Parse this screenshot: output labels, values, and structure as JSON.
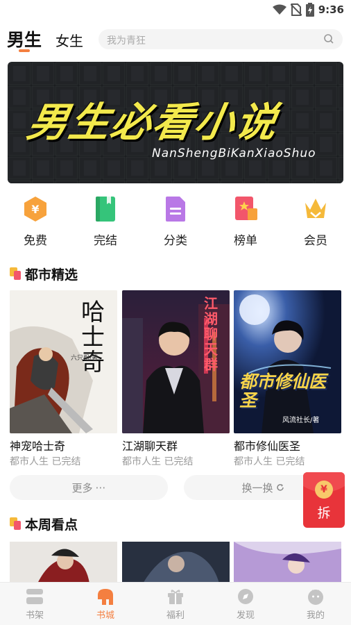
{
  "status_bar": {
    "time": "9:36",
    "icons": [
      "wifi-icon",
      "no-sim-icon",
      "battery-charging-icon"
    ]
  },
  "header": {
    "tabs": [
      {
        "label": "男生",
        "active": true
      },
      {
        "label": "女生",
        "active": false
      }
    ],
    "search_placeholder": "我为青狂",
    "accent": "#f47f40"
  },
  "banner": {
    "title": "男生必看小说",
    "subtitle": "NanShengBiKanXiaoShuo"
  },
  "categories": [
    {
      "label": "免费",
      "icon": "coin-icon",
      "color": "#f7a23c"
    },
    {
      "label": "完结",
      "icon": "book-icon",
      "color": "#35c47a"
    },
    {
      "label": "分类",
      "icon": "document-icon",
      "color": "#b978e6"
    },
    {
      "label": "榜单",
      "icon": "rank-flag-icon",
      "color": "#f2566b"
    },
    {
      "label": "会员",
      "icon": "crown-icon",
      "color": "#f5b93a"
    }
  ],
  "sections": [
    {
      "title": "都市精选",
      "books": [
        {
          "title": "神宠哈士奇",
          "meta": "都市人生 已完结",
          "cover_text": "哈士奇",
          "cover_author": "六只粗/著"
        },
        {
          "title": "江湖聊天群",
          "meta": "都市人生 已完结",
          "cover_text": "江湖聊天群",
          "cover_author": ""
        },
        {
          "title": "都市修仙医圣",
          "meta": "都市人生 已完结",
          "cover_text": "都市修仙医圣",
          "cover_author": "风流社长/著"
        }
      ],
      "more_label": "更多",
      "refresh_label": "换一换"
    },
    {
      "title": "本周看点"
    }
  ],
  "red_packet": {
    "label": "拆",
    "coin": "¥"
  },
  "bottom_nav": [
    {
      "label": "书架",
      "icon": "bookshelf-icon",
      "active": false
    },
    {
      "label": "书城",
      "icon": "book-city-icon",
      "active": true
    },
    {
      "label": "福利",
      "icon": "gift-icon",
      "active": false
    },
    {
      "label": "发现",
      "icon": "discover-icon",
      "active": false
    },
    {
      "label": "我的",
      "icon": "profile-icon",
      "active": false
    }
  ]
}
